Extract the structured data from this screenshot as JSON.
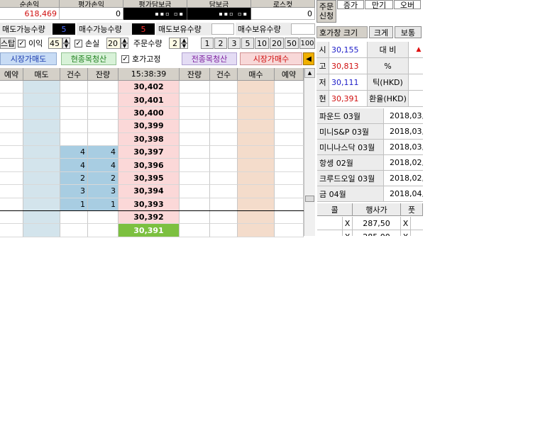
{
  "top": {
    "headers": [
      "순손익",
      "평가손익",
      "평가담보금",
      "담보금",
      "로스컷"
    ],
    "values": [
      "618,469",
      "0",
      "",
      "",
      "0"
    ],
    "order_btn": "주문\n신청",
    "tabs": [
      "증가",
      "만기",
      "오버"
    ]
  },
  "qty": {
    "sell_avail_label": "매도가능수량",
    "sell_avail_val": "5",
    "buy_avail_label": "매수가능수량",
    "buy_avail_val": "5",
    "sell_hold_label": "매도보유수량",
    "buy_hold_label": "매수보유수량"
  },
  "opts": {
    "stop_label": "스탑",
    "profit_label": "이익",
    "profit_val": "45",
    "loss_label": "손실",
    "loss_val": "20",
    "order_qty_label": "주문수량",
    "order_qty_val": "2",
    "qty_buttons": [
      "1",
      "2",
      "3",
      "5",
      "10",
      "20",
      "50",
      "100"
    ]
  },
  "actions": {
    "market_sell": "시장가매도",
    "close_all_sell": "현종목청산",
    "fix_label": "호가고정",
    "close_all_buy": "전종목청산",
    "market_buy": "시장가매수"
  },
  "grid": {
    "headers": [
      "예약",
      "매도",
      "건수",
      "잔량",
      "15:38:39",
      "잔량",
      "건수",
      "매수",
      "예약"
    ],
    "rows": [
      {
        "cnt": "",
        "rem": "",
        "price": "30,402"
      },
      {
        "cnt": "",
        "rem": "",
        "price": "30,401"
      },
      {
        "cnt": "",
        "rem": "",
        "price": "30,400"
      },
      {
        "cnt": "",
        "rem": "",
        "price": "30,399"
      },
      {
        "cnt": "",
        "rem": "",
        "price": "30,398"
      },
      {
        "cnt": "4",
        "rem": "4",
        "price": "30,397"
      },
      {
        "cnt": "4",
        "rem": "4",
        "price": "30,396"
      },
      {
        "cnt": "2",
        "rem": "2",
        "price": "30,395"
      },
      {
        "cnt": "3",
        "rem": "3",
        "price": "30,394"
      },
      {
        "cnt": "1",
        "rem": "1",
        "price": "30,393"
      },
      {
        "cnt": "",
        "rem": "",
        "price": "30,392"
      },
      {
        "cnt": "",
        "rem": "",
        "price": "30,391"
      }
    ]
  },
  "side": {
    "size_label": "호가창 크기",
    "size_big": "크게",
    "size_normal": "보통",
    "quote_rows": [
      {
        "k": "시",
        "v": "30,155",
        "k2": "대 비",
        "v2": ""
      },
      {
        "k": "고",
        "v": "30,813",
        "k2": "%",
        "v2": ""
      },
      {
        "k": "저",
        "v": "30,111",
        "k2": "틱(HKD)",
        "v2": ""
      },
      {
        "k": "현",
        "v": "30,391",
        "k2": "환율(HKD)",
        "v2": ""
      }
    ],
    "colors": {
      "open": "#1c1cc8",
      "high": "#d01010",
      "low": "#1c1cc8",
      "cur": "#d01010"
    },
    "futures": [
      {
        "name": "파운드 03월",
        "date": "2018,03,"
      },
      {
        "name": "미니S&P 03월",
        "date": "2018,03,"
      },
      {
        "name": "미니나스닥 03월",
        "date": "2018,03,"
      },
      {
        "name": "항셍 02월",
        "date": "2018,02,"
      },
      {
        "name": "크루드오일 03월",
        "date": "2018,02,"
      },
      {
        "name": "금 04월",
        "date": "2018,04,"
      }
    ],
    "opt_headers": [
      "콜",
      "행사가",
      "풋"
    ],
    "opt_rows": [
      {
        "x1": "X",
        "strike": "287,50",
        "x2": "X"
      },
      {
        "x1": "X",
        "strike": "285,00",
        "x2": "X"
      }
    ]
  }
}
